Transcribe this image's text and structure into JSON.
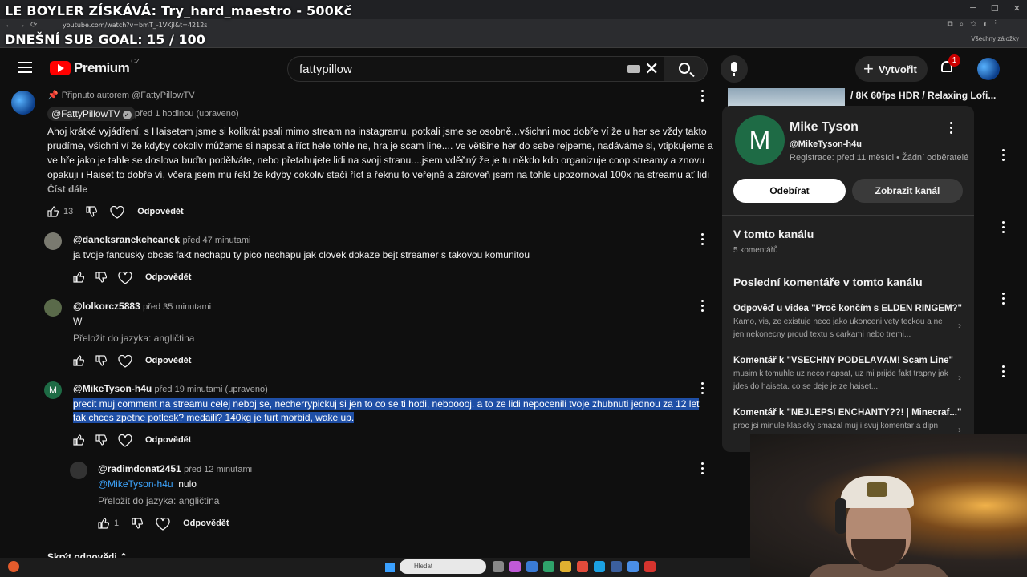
{
  "overlay": {
    "title": "LE BOYLER ZÍSKÁVÁ: Try_hard_maestro - 500Kč",
    "goal": "DNEŠNÍ SUB GOAL: 15 / 100"
  },
  "browser": {
    "url": "youtube.com/watch?v=bmT_-1VKjl&t=4212s",
    "bookmarks_label": "Všechny záložky"
  },
  "header": {
    "logo_word": "Premium",
    "logo_country": "CZ",
    "search_value": "fattypillow",
    "create_label": "Vytvořit",
    "notification_count": "1"
  },
  "pinned": {
    "pin_label": "Připnuto autorem @FattyPillowTV",
    "author": "@FattyPillowTV",
    "meta": "před 1 hodinou (upraveno)",
    "text": "Ahoj krátké vyjádření, s Haisetem jsme si kolikrát psali mimo stream na instagramu, potkali jsme se osobně...všichni moc dobře ví že u her se vždy takto prudíme, všichni ví že kdyby cokoliv můžeme si napsat a říct hele tohle ne, hra je scam line.... ve většine her do sebe rejpeme, nadáváme si, vtipkujeme a ve hře jako je tahle se doslova buďto podělváte, nebo přetahujete lidi na svoji stranu....jsem vděčný že je tu někdo kdo organizuje coop streamy a znovu opakuji i Haiset to dobře ví, včera jsem mu řekl že kdyby cokoliv stačí říct a řeknu to veřejně a zároveň jsem na tohle upozornoval 100x na streamu ať lidi ...",
    "read_more": "Číst dále",
    "likes": "13",
    "reply_label": "Odpovědět"
  },
  "comments": [
    {
      "handle": "@daneksranekchcanek",
      "meta": "před 47 minutami",
      "text": "ja tvoje fanousky obcas fakt nechapu ty pico nechapu jak clovek dokaze bejt streamer s takovou komunitou",
      "reply_label": "Odpovědět"
    },
    {
      "handle": "@lolkorcz5883",
      "meta": "před 35 minutami",
      "text": "W",
      "translate": "Přeložit do jazyka: angličtina",
      "reply_label": "Odpovědět"
    },
    {
      "handle": "@MikeTyson-h4u",
      "avatar_letter": "M",
      "meta": "před 19 minutami (upraveno)",
      "text_line1": "precit muj comment na streamu celej neboj se, necherrypickuj si jen to co se ti hodi, nebooooj. a to ze lidi nepocenili tvoje zhubnuti jednou za 12 let",
      "text_line2": "tak chces zpetne potlesk? medaili? 140kg je furt morbid, wake up.",
      "reply_label": "Odpovědět"
    },
    {
      "handle": "@radimdonat2451",
      "meta": "před 12 minutami",
      "mention": "@MikeTyson-h4u",
      "text": "nulo",
      "translate": "Přeložit do jazyka: angličtina",
      "likes": "1",
      "reply_label": "Odpovědět"
    }
  ],
  "hide_replies": "Skrýt odpovědi",
  "right_list": {
    "top_title": "/ 8K 60fps HDR / Relaxing Lofi..."
  },
  "card": {
    "avatar_letter": "M",
    "name": "Mike Tyson",
    "handle": "@MikeTyson-h4u",
    "registration": "Registrace: před 11 měsíci • Žádní odběratelé",
    "subscribe_label": "Odebírat",
    "view_channel_label": "Zobrazit kanál",
    "section1_title": "V tomto kanálu",
    "section1_sub": "5 komentářů",
    "section2_title": "Poslední komentáře v tomto kanálu",
    "recent": [
      {
        "title": "Odpověď u videa \"Proč končím s ELDEN RINGEM?\"",
        "snippet": "Kamo, vis, ze existuje neco jako ukonceni vety teckou a ne jen nekonecny proud textu s carkami nebo tremi..."
      },
      {
        "title": "Komentář k \"VŠECHNY PODĚLÁVÁM! Scam Line\"",
        "snippet": "musim k tomuhle uz neco napsat, uz mi prijde fakt trapny jak jdes do haiseta. co se deje je ze haiset..."
      },
      {
        "title": "Komentář k \"NEJLEPŠÍ ENCHANTY??! | Minecraf...\"",
        "snippet": "proc jsi minule klasicky smazal muj i svuj komentar a dipn"
      }
    ]
  },
  "taskbar": {
    "search_label": "Hledat"
  }
}
